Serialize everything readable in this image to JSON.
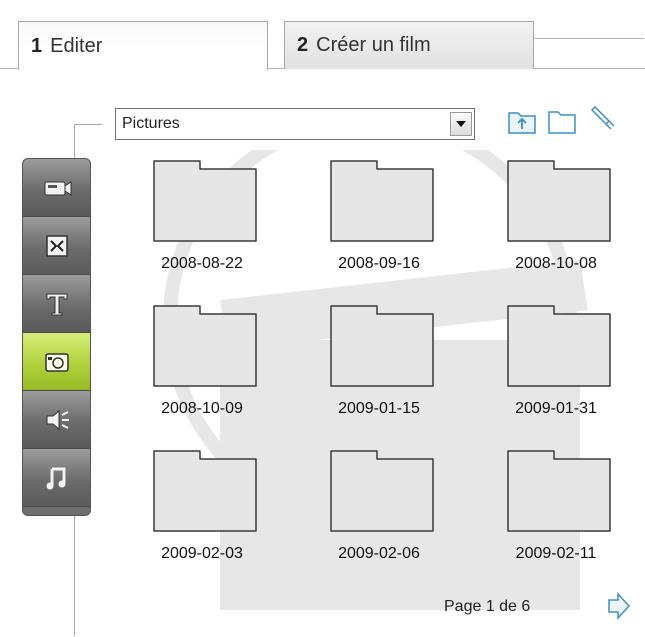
{
  "tabs": [
    {
      "num": "1",
      "label": "Editer"
    },
    {
      "num": "2",
      "label": "Créer un film"
    }
  ],
  "folder_select": {
    "value": "Pictures"
  },
  "toolbar_icons": [
    "folder-up-icon",
    "new-folder-icon",
    "rename-folder-icon"
  ],
  "sidebar": [
    {
      "icon": "video-camera-icon",
      "active": false
    },
    {
      "icon": "transition-icon",
      "active": false
    },
    {
      "icon": "text-icon",
      "active": false
    },
    {
      "icon": "camera-icon",
      "active": true
    },
    {
      "icon": "speaker-icon",
      "active": false
    },
    {
      "icon": "music-note-icon",
      "active": false
    }
  ],
  "folders": [
    "2008-08-22",
    "2008-09-16",
    "2008-10-08",
    "2008-10-09",
    "2009-01-15",
    "2009-01-31",
    "2009-02-03",
    "2009-02-06",
    "2009-02-11"
  ],
  "pager": {
    "text": "Page 1 de 6"
  },
  "colors": {
    "active_tool": "#b0d23c",
    "toolbar": "#6e6e6e",
    "folder_fill": "#e6e6e6"
  }
}
